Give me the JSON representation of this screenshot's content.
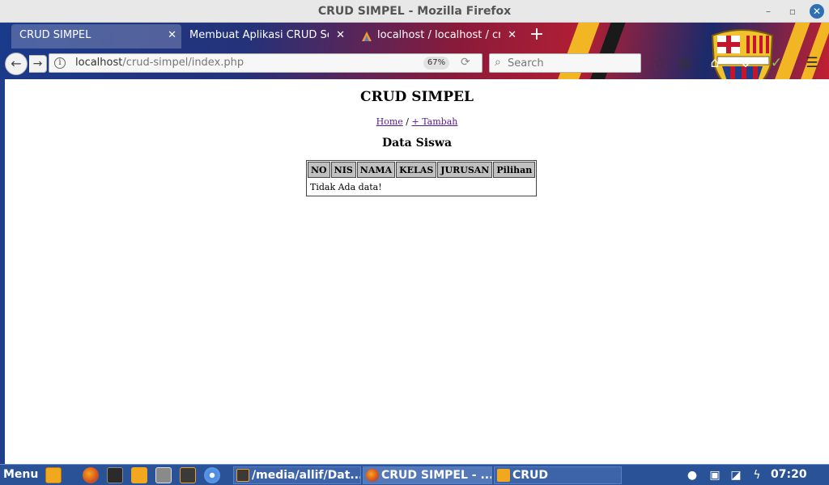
{
  "window": {
    "title": "CRUD SIMPEL - Mozilla Firefox",
    "minimize_glyph": "–",
    "restore_glyph": "▫",
    "close_glyph": "✕"
  },
  "tabs": [
    {
      "label": "CRUD SIMPEL",
      "active": true
    },
    {
      "label": "Membuat Aplikasi CRUD Sed...",
      "active": false
    },
    {
      "label": "localhost / localhost / cru...",
      "active": false,
      "icon": "phpmyadmin-icon"
    }
  ],
  "new_tab_glyph": "+",
  "tab_close_glyph": "✕",
  "navbar": {
    "back_glyph": "←",
    "forward_glyph": "→",
    "url_host": "localhost",
    "url_path": "/crud-simpel/index.php",
    "zoom": "67%",
    "search_placeholder": "Search",
    "icons": [
      "bookmark-star-icon",
      "reading-list-icon",
      "home-icon",
      "pocket-icon",
      "checkmark-icon",
      "hamburger-menu-icon"
    ]
  },
  "page": {
    "heading": "CRUD SIMPEL",
    "link_home": "Home",
    "link_separator": " / ",
    "link_add": "+ Tambah",
    "subheading": "Data Siswa",
    "table": {
      "headers": [
        "NO",
        "NIS",
        "NAMA",
        "KELAS",
        "JURUSAN",
        "Pilihan"
      ],
      "empty_message": "Tidak Ada data!"
    }
  },
  "taskbar": {
    "menu_label": "Menu",
    "launchers": [
      "show-desktop-icon",
      "firefox-icon",
      "terminal-icon",
      "files-icon",
      "screenshot-icon",
      "sublime-icon",
      "chromium-icon"
    ],
    "tasks": [
      {
        "label": "/media/allif/Dat...",
        "icon": "sublime-icon",
        "active": false
      },
      {
        "label": "CRUD SIMPEL - ...",
        "icon": "firefox-icon",
        "active": true
      },
      {
        "label": "CRUD",
        "icon": "folder-icon",
        "active": false
      }
    ],
    "tray_icons": [
      "user-icon",
      "network-icon",
      "update-icon",
      "power-icon"
    ],
    "clock": "07:20"
  },
  "colors": {
    "taskbar": "#2a5297",
    "link": "#551a8b",
    "table_header": "#c0c0c0"
  }
}
